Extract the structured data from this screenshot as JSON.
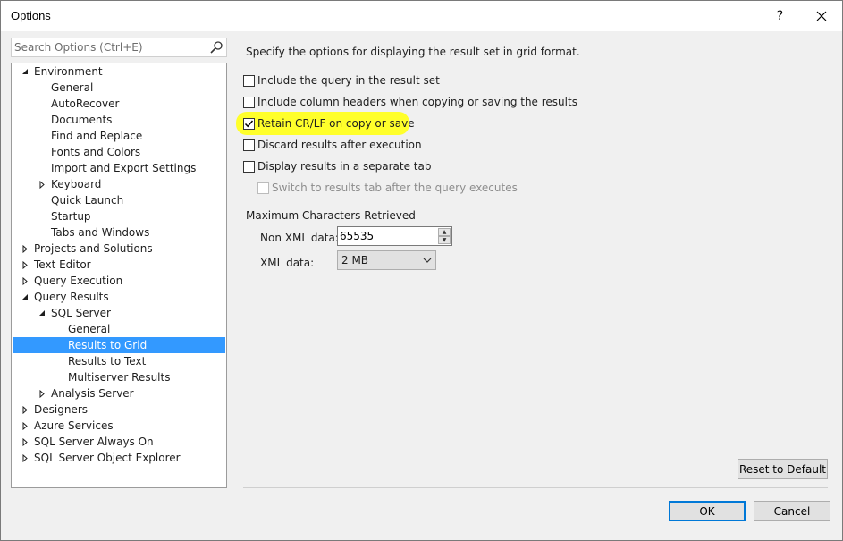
{
  "window": {
    "title": "Options",
    "help_label": "?",
    "close_label": "✕"
  },
  "search": {
    "placeholder": "Search Options (Ctrl+E)"
  },
  "tree": {
    "items": [
      {
        "label": "Environment",
        "expander": "expanded"
      },
      {
        "label": "General",
        "expander": "none"
      },
      {
        "label": "AutoRecover",
        "expander": "none"
      },
      {
        "label": "Documents",
        "expander": "none"
      },
      {
        "label": "Find and Replace",
        "expander": "none"
      },
      {
        "label": "Fonts and Colors",
        "expander": "none"
      },
      {
        "label": "Import and Export Settings",
        "expander": "none"
      },
      {
        "label": "Keyboard",
        "expander": "collapsed"
      },
      {
        "label": "Quick Launch",
        "expander": "none"
      },
      {
        "label": "Startup",
        "expander": "none"
      },
      {
        "label": "Tabs and Windows",
        "expander": "none"
      },
      {
        "label": "Projects and Solutions",
        "expander": "collapsed"
      },
      {
        "label": "Text Editor",
        "expander": "collapsed"
      },
      {
        "label": "Query Execution",
        "expander": "collapsed"
      },
      {
        "label": "Query Results",
        "expander": "expanded"
      },
      {
        "label": "SQL Server",
        "expander": "expanded"
      },
      {
        "label": "General",
        "expander": "none"
      },
      {
        "label": "Results to Grid",
        "expander": "none",
        "selected": true
      },
      {
        "label": "Results to Text",
        "expander": "none"
      },
      {
        "label": "Multiserver Results",
        "expander": "none"
      },
      {
        "label": "Analysis Server",
        "expander": "collapsed"
      },
      {
        "label": "Designers",
        "expander": "collapsed"
      },
      {
        "label": "Azure Services",
        "expander": "collapsed"
      },
      {
        "label": "SQL Server Always On",
        "expander": "collapsed"
      },
      {
        "label": "SQL Server Object Explorer",
        "expander": "collapsed"
      }
    ]
  },
  "panel": {
    "description": "Specify the options for displaying the result set in grid format.",
    "options": [
      {
        "label": "Include the query in the result set",
        "checked": false,
        "enabled": true
      },
      {
        "label": "Include column headers when copying or saving the results",
        "checked": false,
        "enabled": true
      },
      {
        "label": "Retain CR/LF on copy or save",
        "checked": true,
        "enabled": true,
        "highlighted": true
      },
      {
        "label": "Discard results after execution",
        "checked": false,
        "enabled": true
      },
      {
        "label": "Display results in a separate tab",
        "checked": false,
        "enabled": true
      },
      {
        "label": "Switch to results tab after the query executes",
        "checked": false,
        "enabled": false
      }
    ],
    "group_title": "Maximum Characters Retrieved",
    "non_xml_label": "Non XML data:",
    "non_xml_value": "65535",
    "xml_label": "XML data:",
    "xml_value": "2 MB",
    "reset_label": "Reset to Default"
  },
  "footer": {
    "ok_label": "OK",
    "cancel_label": "Cancel"
  },
  "colors": {
    "selection": "#3399ff",
    "highlight": "#ffff2b",
    "default_button_border": "#0078d7"
  }
}
